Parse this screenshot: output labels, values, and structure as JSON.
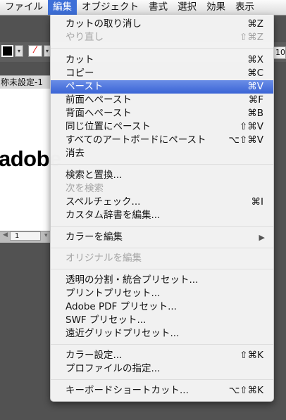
{
  "menubar": {
    "items": [
      "ファイル",
      "編集",
      "オブジェクト",
      "書式",
      "選択",
      "効果",
      "表示"
    ],
    "active_index": 1
  },
  "background": {
    "doc_tab": "称未設定-1",
    "canvas_text": "adobe",
    "status_page": "1",
    "right_value": "10"
  },
  "menu": {
    "items": [
      {
        "label": "カットの取り消し",
        "shortcut": "⌘Z",
        "disabled": false
      },
      {
        "label": "やり直し",
        "shortcut": "⇧⌘Z",
        "disabled": true
      },
      {
        "label": "カット",
        "shortcut": "⌘X",
        "disabled": false
      },
      {
        "label": "コピー",
        "shortcut": "⌘C",
        "disabled": false
      },
      {
        "label": "ペースト",
        "shortcut": "⌘V",
        "highlighted": true
      },
      {
        "label": "前面へペースト",
        "shortcut": "⌘F"
      },
      {
        "label": "背面へペースト",
        "shortcut": "⌘B"
      },
      {
        "label": "同じ位置にペースト",
        "shortcut": "⇧⌘V"
      },
      {
        "label": "すべてのアートボードにペースト",
        "shortcut": "⌥⇧⌘V"
      },
      {
        "label": "消去",
        "shortcut": ""
      },
      {
        "label": "検索と置換...",
        "shortcut": ""
      },
      {
        "label": "次を検索",
        "shortcut": "",
        "disabled": true
      },
      {
        "label": "スペルチェック...",
        "shortcut": "⌘I"
      },
      {
        "label": "カスタム辞書を編集...",
        "shortcut": ""
      },
      {
        "label": "カラーを編集",
        "shortcut": "▶",
        "submenu": true
      },
      {
        "label": "オリジナルを編集",
        "shortcut": "",
        "disabled": true
      },
      {
        "label": "透明の分割・統合プリセット...",
        "shortcut": ""
      },
      {
        "label": "プリントプリセット...",
        "shortcut": ""
      },
      {
        "label": "Adobe PDF プリセット...",
        "shortcut": ""
      },
      {
        "label": "SWF プリセット...",
        "shortcut": ""
      },
      {
        "label": "遠近グリッドプリセット...",
        "shortcut": ""
      },
      {
        "label": "カラー設定...",
        "shortcut": "⇧⌘K"
      },
      {
        "label": "プロファイルの指定...",
        "shortcut": ""
      },
      {
        "label": "キーボードショートカット...",
        "shortcut": "⌥⇧⌘K"
      }
    ]
  },
  "colors": {
    "highlight": "#3a64d6",
    "menubar_active": "#3d6fd8",
    "disabled_text": "#a4a4a4"
  }
}
